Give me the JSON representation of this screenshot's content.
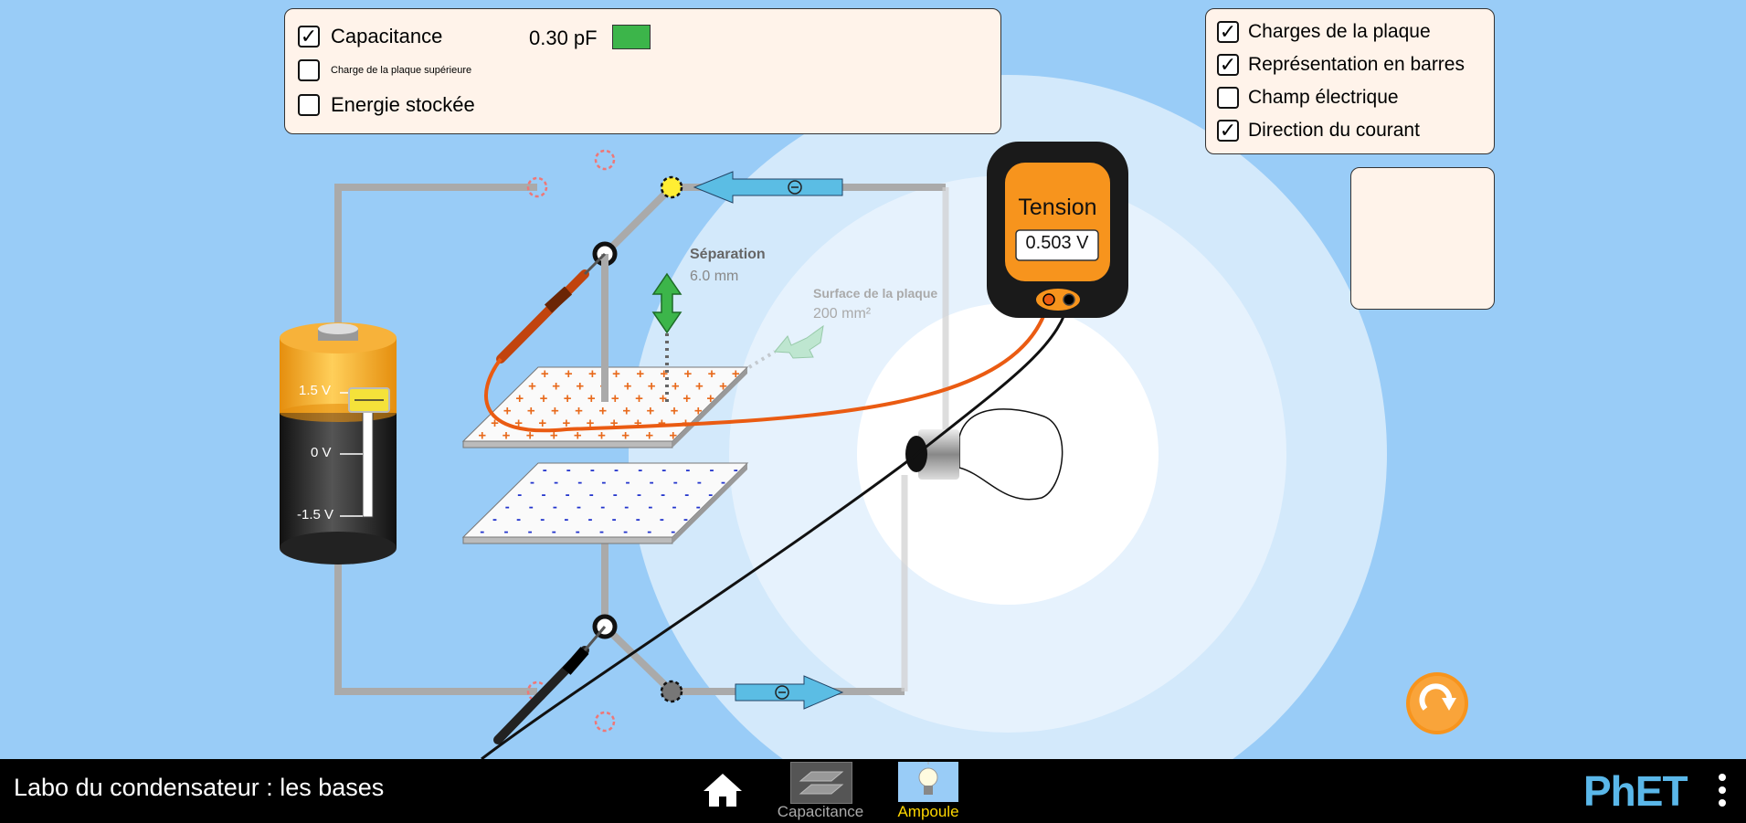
{
  "app": {
    "title": "Labo du condensateur : les bases",
    "brand": "PhET"
  },
  "meters_panel": {
    "capacitance": {
      "label": "Capacitance",
      "value": "0.30 pF",
      "checked": true,
      "bar_color": "#3cb54a"
    },
    "top_plate_charge": {
      "label": "Charge de la plaque supérieure",
      "checked": false
    },
    "stored_energy": {
      "label": "Energie stockée",
      "checked": false
    }
  },
  "view_panel": {
    "items": [
      {
        "label": "Charges de la plaque",
        "checked": true
      },
      {
        "label": "Représentation en barres",
        "checked": true
      },
      {
        "label": "Champ électrique",
        "checked": false
      },
      {
        "label": "Direction du courant",
        "checked": true
      }
    ]
  },
  "voltmeter": {
    "title": "Tension",
    "reading": "0.503 V"
  },
  "battery": {
    "voltage_labels": [
      "1.5 V",
      "0 V",
      "-1.5 V"
    ]
  },
  "capacitor": {
    "separation_label": "Séparation",
    "separation_value": "6.0 mm",
    "area_label": "Surface de la plaque",
    "area_value": "200 mm²"
  },
  "nav": {
    "home_label": "",
    "capacitance_tab": "Capacitance",
    "lightbulb_tab": "Ampoule"
  },
  "colors": {
    "background": "#99ccf7",
    "panel": "#fff3ea",
    "wire": "#aaaaaa",
    "voltmeter_body": "#f7941d",
    "current_arrow": "#5bbde4",
    "active_tab": "#ffd700",
    "positive_charge": "#e86a1c",
    "negative_charge": "#2233cc"
  }
}
